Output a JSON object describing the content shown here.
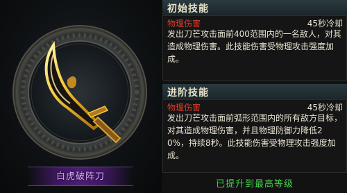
{
  "skill": {
    "name": "白虎破阵刀"
  },
  "initial": {
    "title": "初始技能",
    "damage_type": "物理伤害",
    "cooldown": "45秒冷却",
    "description": "发出刀芒攻击面前400范围内的一名敌人，对其造成物理伤害。此技能伤害受物理攻击强度加成。"
  },
  "advanced": {
    "title": "进阶技能",
    "damage_type": "物理伤害",
    "cooldown": "45秒冷却",
    "description": "发出刀芒攻击面前弧形范围内的所有敌方目标，对其造成物理伤害，并且物理防御力降低20%，持续8秒。此技能伤害受物理攻击强度加成。"
  },
  "status": {
    "max_level": "已提升到最高等级"
  },
  "colors": {
    "damage": "#e03a2a",
    "max_level": "#44d24a",
    "skill_name": "#d9a9ff",
    "blade_glow": "#f2c93a"
  },
  "icons": [
    "blade-icon",
    "emblem-ring"
  ]
}
